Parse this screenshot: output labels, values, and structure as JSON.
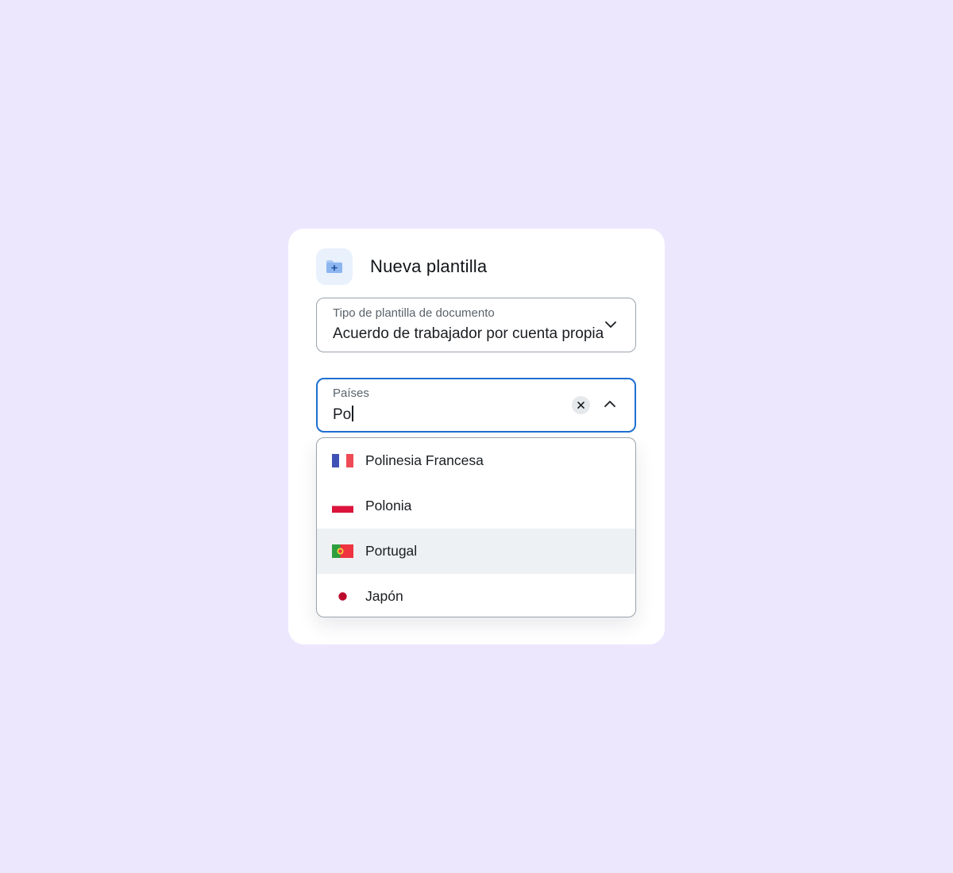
{
  "dialog": {
    "title": "Nueva plantilla",
    "icon": "folder-plus-icon"
  },
  "template_type": {
    "label": "Tipo de plantilla de documento",
    "value": "Acuerdo de trabajador por cuenta propia",
    "icon": "chevron-down-icon"
  },
  "countries": {
    "label": "Países",
    "value": "Po",
    "clear_icon": "close-icon",
    "toggle_icon": "chevron-up-icon",
    "focus_color": "#1f6fd0",
    "options": [
      {
        "label": "Polinesia Francesa",
        "flag": "flag-french-polynesia-icon",
        "highlighted": false
      },
      {
        "label": "Polonia",
        "flag": "flag-poland-icon",
        "highlighted": false
      },
      {
        "label": "Portugal",
        "flag": "flag-portugal-icon",
        "highlighted": true
      },
      {
        "label": "Japón",
        "flag": "flag-japan-icon",
        "highlighted": false
      }
    ]
  },
  "colors": {
    "background": "#ede7fe",
    "card": "#ffffff",
    "highlight": "#eef1f4",
    "icon_tile": "#e9f1fd"
  }
}
